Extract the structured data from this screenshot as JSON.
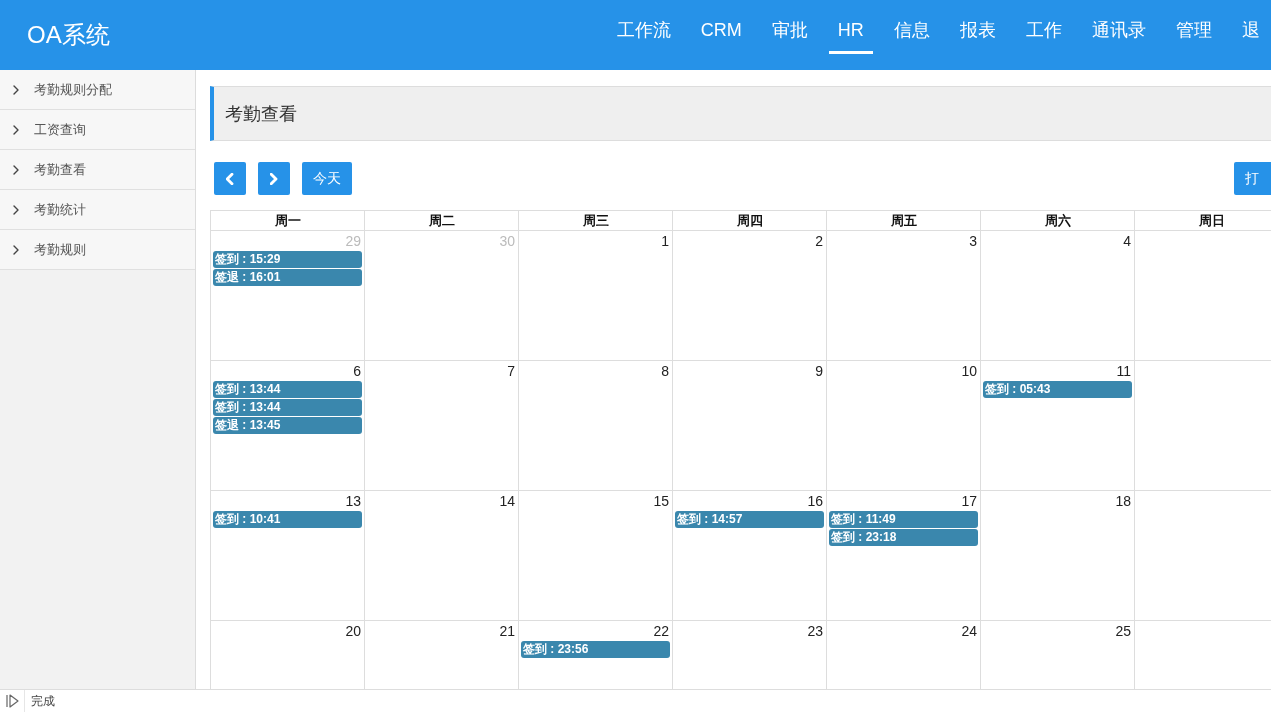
{
  "header": {
    "logo": "OA系统",
    "nav": [
      {
        "label": "工作流",
        "selected": false
      },
      {
        "label": "CRM",
        "selected": false
      },
      {
        "label": "审批",
        "selected": false
      },
      {
        "label": "HR",
        "selected": true
      },
      {
        "label": "信息",
        "selected": false
      },
      {
        "label": "报表",
        "selected": false
      },
      {
        "label": "工作",
        "selected": false
      },
      {
        "label": "通讯录",
        "selected": false
      },
      {
        "label": "管理",
        "selected": false
      },
      {
        "label": "退",
        "selected": false
      }
    ]
  },
  "sidebar": {
    "items": [
      {
        "label": "考勤规则分配"
      },
      {
        "label": "工资查询"
      },
      {
        "label": "考勤查看"
      },
      {
        "label": "考勤统计"
      },
      {
        "label": "考勤规则"
      }
    ]
  },
  "page_title": "考勤查看",
  "toolbar": {
    "today_button": "今天",
    "punch_button": "打"
  },
  "calendar": {
    "weekdays": [
      "周一",
      "周二",
      "周三",
      "周四",
      "周五",
      "周六",
      "周日"
    ],
    "weeks": [
      {
        "days": [
          {
            "day": "29",
            "other_month": true,
            "events": [
              "签到 : 15:29",
              "签退 : 16:01"
            ]
          },
          {
            "day": "30",
            "other_month": true
          },
          {
            "day": "1",
            "other_month": false
          },
          {
            "day": "2",
            "other_month": false
          },
          {
            "day": "3",
            "other_month": false
          },
          {
            "day": "4",
            "other_month": false
          }
        ]
      },
      {
        "days": [
          {
            "day": "6",
            "other_month": false,
            "events": [
              "签到 : 13:44",
              "签到 : 13:44",
              "签退 : 13:45"
            ]
          },
          {
            "day": "7",
            "other_month": false
          },
          {
            "day": "8",
            "other_month": false
          },
          {
            "day": "9",
            "other_month": false
          },
          {
            "day": "10",
            "other_month": false
          },
          {
            "day": "11",
            "other_month": false,
            "events": [
              "签到 : 05:43"
            ]
          }
        ]
      },
      {
        "days": [
          {
            "day": "13",
            "other_month": false,
            "events": [
              "签到 : 10:41"
            ]
          },
          {
            "day": "14",
            "other_month": false
          },
          {
            "day": "15",
            "other_month": false
          },
          {
            "day": "16",
            "other_month": false,
            "events": [
              "签到 : 14:57"
            ]
          },
          {
            "day": "17",
            "other_month": false,
            "events": [
              "签到 : 11:49",
              "签到 : 23:18"
            ]
          },
          {
            "day": "18",
            "other_month": false
          }
        ]
      },
      {
        "days": [
          {
            "day": "20",
            "other_month": false
          },
          {
            "day": "21",
            "other_month": false
          },
          {
            "day": "22",
            "other_month": false,
            "events": [
              "签到 : 23:56"
            ]
          },
          {
            "day": "23",
            "other_month": false
          },
          {
            "day": "24",
            "other_month": false
          },
          {
            "day": "25",
            "other_month": false
          }
        ]
      }
    ]
  },
  "status_bar": {
    "text": "完成"
  }
}
